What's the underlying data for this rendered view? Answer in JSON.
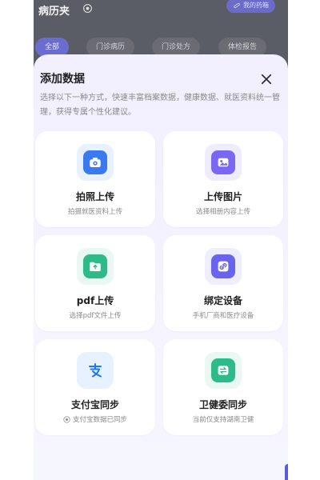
{
  "background_page": {
    "title": "病历夹",
    "my_meds_label": "我的药箱",
    "tabs": [
      "全部",
      "门诊病历",
      "门诊处方",
      "体检报告"
    ],
    "active_tab_index": 0
  },
  "sheet": {
    "title": "添加数据",
    "description": "选择以下一种方式，快速丰富档案数据，健康数据、就医资料统一管理，获得专属个性化建议。",
    "options": [
      {
        "label": "拍照上传",
        "sub": "拍摄就医资料上传",
        "icon": "camera-icon"
      },
      {
        "label": "上传图片",
        "sub": "选择相册内容上传",
        "icon": "image-icon"
      },
      {
        "label": "pdf上传",
        "sub": "选择pdf文件上传",
        "icon": "upload-folder-icon"
      },
      {
        "label": "绑定设备",
        "sub": "手机厂商和医疗设备",
        "icon": "link-icon"
      },
      {
        "label": "支付宝同步",
        "sub": "支付宝数据已同步",
        "icon": "alipay-icon"
      },
      {
        "label": "卫健委同步",
        "sub": "当前仅支持湖南卫健",
        "icon": "sync-icon"
      }
    ]
  },
  "colors": {
    "accent": "#6b6cd0",
    "sheet_bg": "#f3f1ff",
    "dim_bg": "#5b5d66",
    "camera": "#3b79f0",
    "image": "#7a68f2",
    "pdf": "#2dbb8a",
    "device": "#6a63f0",
    "alipay": "#1677ff",
    "sync": "#2dbb8a"
  }
}
